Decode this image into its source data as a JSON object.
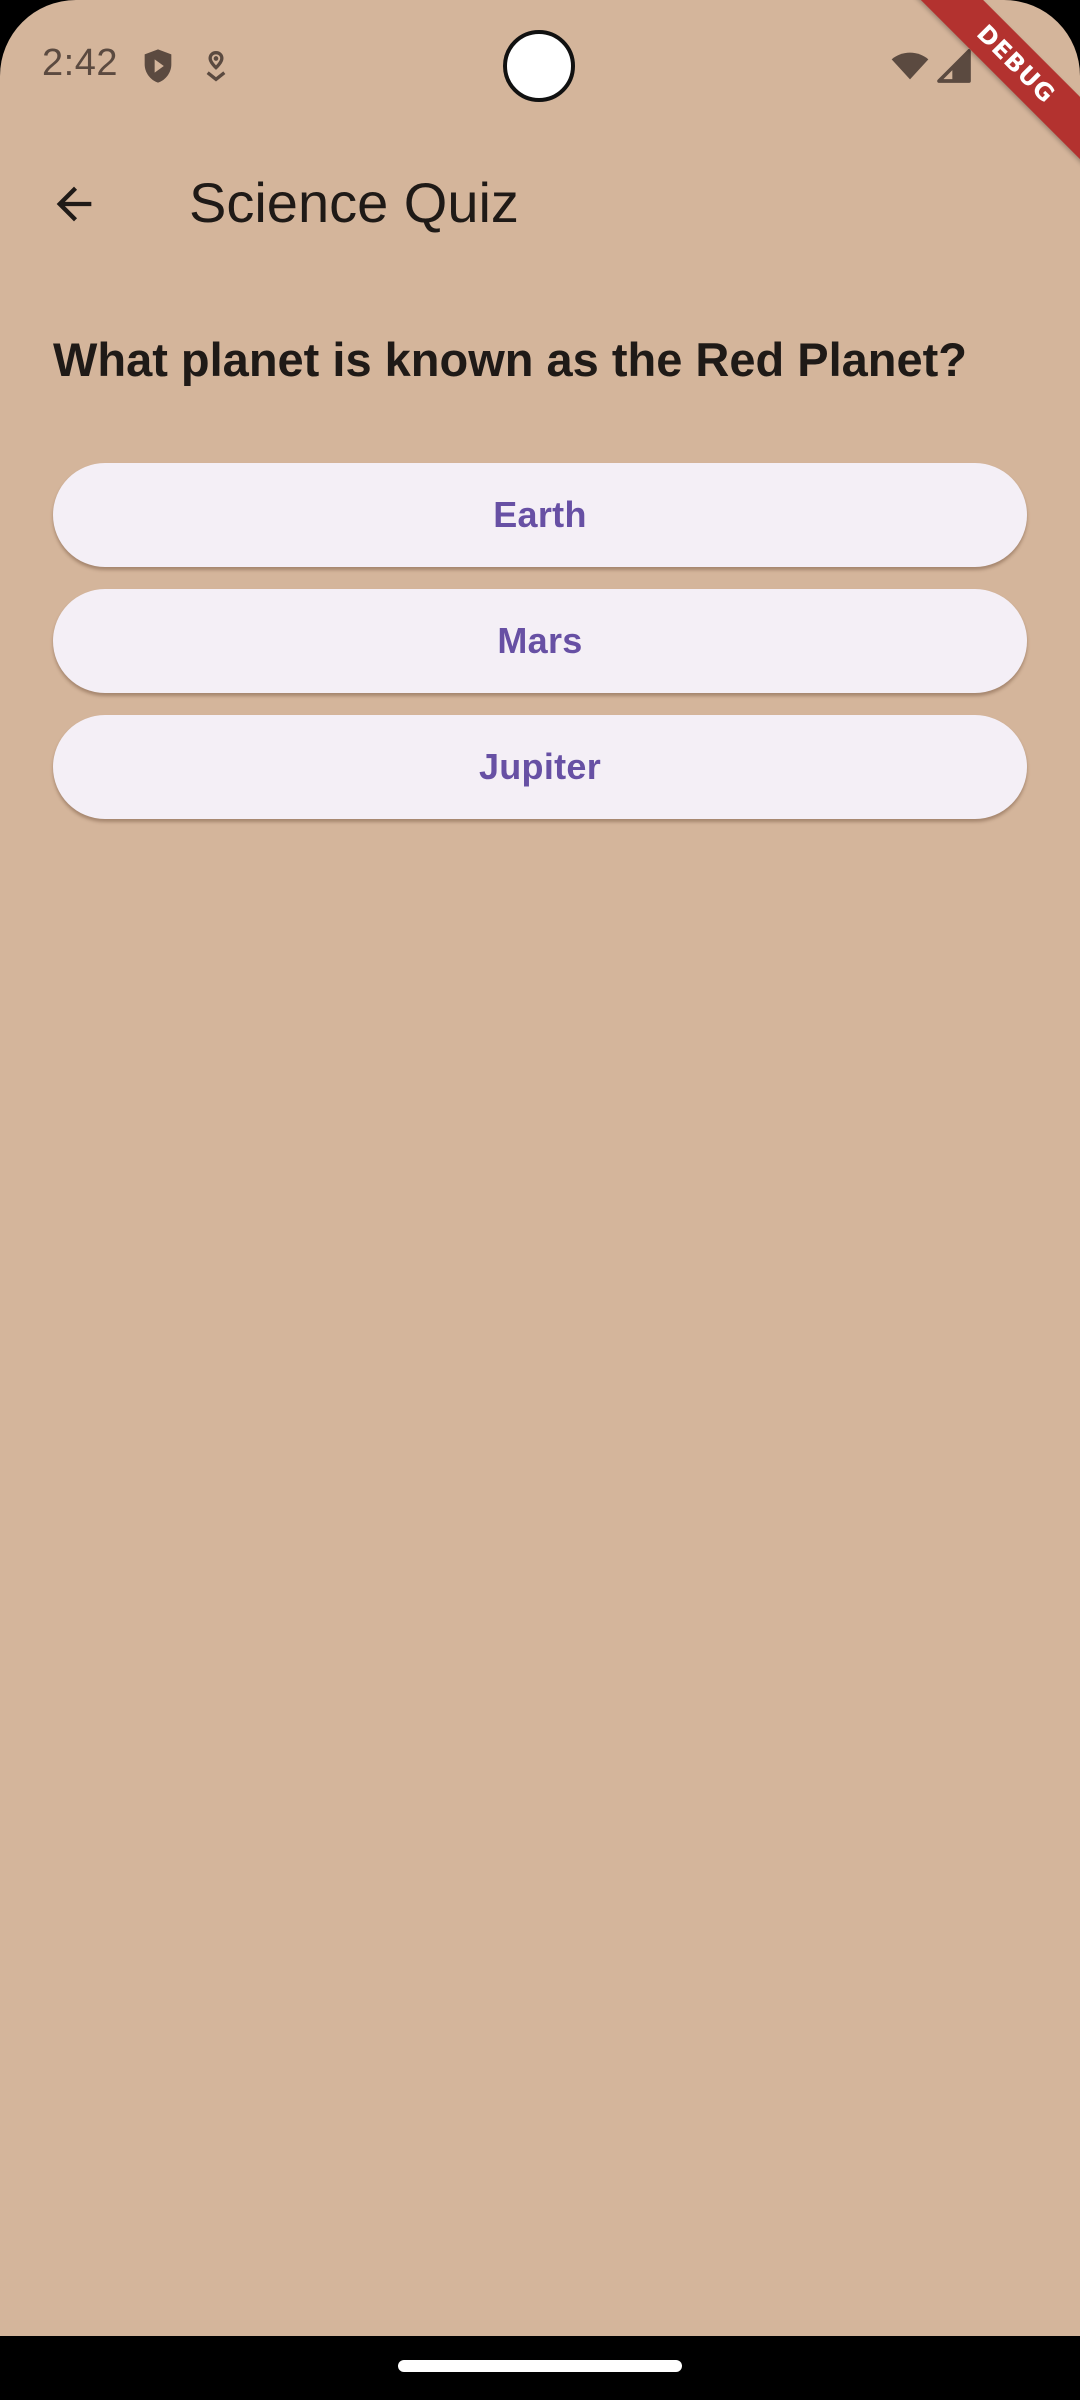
{
  "status_bar": {
    "time": "2:42",
    "icons": [
      "shield-play-icon",
      "location-icon",
      "wifi-icon",
      "signal-icon"
    ]
  },
  "debug_banner": {
    "label": "DEBUG",
    "color": "#B3322F"
  },
  "app_bar": {
    "back_icon": "arrow-back-icon",
    "title": "Science Quiz"
  },
  "question": {
    "text": "What planet is known as the Red Planet?"
  },
  "answers": [
    {
      "label": "Earth"
    },
    {
      "label": "Mars"
    },
    {
      "label": "Jupiter"
    }
  ],
  "colors": {
    "background": "#D4B59B",
    "button_background": "#F4EFF6",
    "button_text": "#6750A4",
    "text_primary": "#1F1A17"
  }
}
